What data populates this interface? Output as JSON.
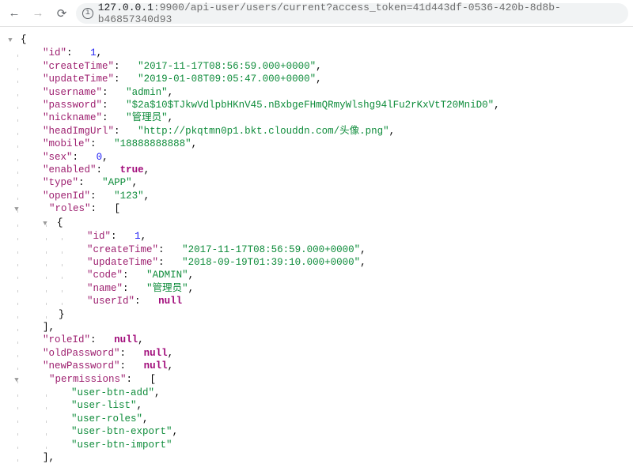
{
  "toolbar": {
    "urlHost": "127.0.0.1",
    "urlPort": ":9900",
    "urlPath": "/api-user/users/current?access_token=41d443df-0536-420b-8d8b-b46857340d93"
  },
  "obj": {
    "id": 1,
    "createTime": "2017-11-17T08:56:59.000+0000",
    "updateTime": "2019-01-08T09:05:47.000+0000",
    "username": "admin",
    "password": "$2a$10$TJkwVdlpbHKnV45.nBxbgeFHmQRmyWlshg94lFu2rKxVtT20MniD0",
    "nickname": "管理员",
    "headImgUrl": "http://pkqtmn0p1.bkt.clouddn.com/头像.png",
    "mobile": "18888888888",
    "sex": 0,
    "enabled": true,
    "type": "APP",
    "openId": "123",
    "roles_label": "roles",
    "roles": [
      {
        "id": 1,
        "createTime": "2017-11-17T08:56:59.000+0000",
        "updateTime": "2018-09-19T01:39:10.000+0000",
        "code": "ADMIN",
        "name": "管理员",
        "userId": null
      }
    ],
    "roleId": null,
    "oldPassword": null,
    "newPassword": null,
    "permissions_label": "permissions",
    "permissions": [
      "user-btn-add",
      "user-list",
      "user-roles",
      "user-btn-export",
      "user-btn-import"
    ]
  },
  "keys": {
    "id": "id",
    "createTime": "createTime",
    "updateTime": "updateTime",
    "username": "username",
    "password": "password",
    "nickname": "nickname",
    "headImgUrl": "headImgUrl",
    "mobile": "mobile",
    "sex": "sex",
    "enabled": "enabled",
    "type": "type",
    "openId": "openId",
    "code": "code",
    "name": "name",
    "userId": "userId",
    "roleId": "roleId",
    "oldPassword": "oldPassword",
    "newPassword": "newPassword"
  },
  "lit": {
    "nullStr": "null",
    "trueStr": "true"
  }
}
